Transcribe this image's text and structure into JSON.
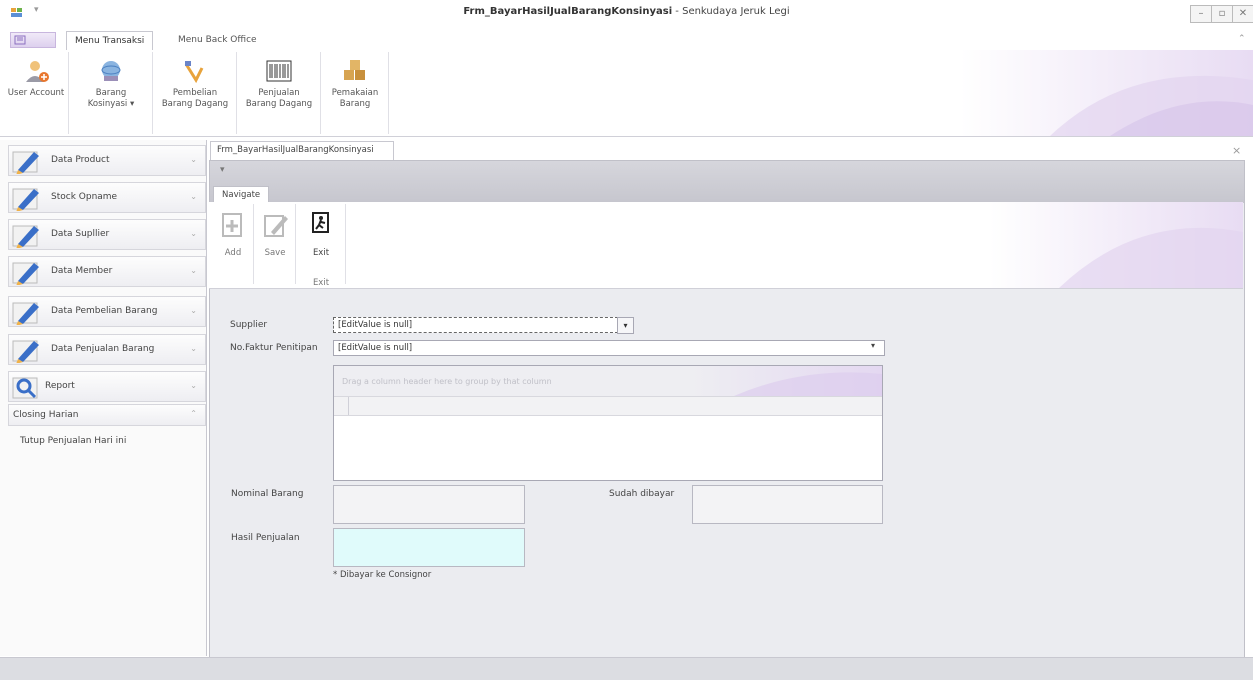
{
  "window": {
    "title_bold": "Frm_BayarHasilJualBarangKonsinyasi",
    "title_rest": " - Senkudaya Jeruk Legi",
    "buttons": [
      "–",
      "▫",
      "✕"
    ]
  },
  "ribbon": {
    "tabs": [
      "Menu Transaksi",
      "Menu Back Office"
    ],
    "buttons": [
      {
        "line1": "User Account",
        "line2": ""
      },
      {
        "line1": "Barang",
        "line2": "Kosinyasi ▾"
      },
      {
        "line1": "Pembelian",
        "line2": "Barang Dagang"
      },
      {
        "line1": "Penjualan",
        "line2": "Barang Dagang"
      },
      {
        "line1": "Pemakaian",
        "line2": "Barang"
      }
    ]
  },
  "sidebar": {
    "items": [
      {
        "label": "Data Product"
      },
      {
        "label": "Stock Opname"
      },
      {
        "label": "Data Supllier"
      },
      {
        "label": "Data Member"
      },
      {
        "label": "Data Pembelian Barang"
      },
      {
        "label": "Data Penjualan Barang"
      },
      {
        "label": "Report"
      }
    ],
    "closing": {
      "label": "Closing Harian",
      "sub_item": "Tutup Penjualan Hari ini"
    }
  },
  "document": {
    "tab_title": "Frm_BayarHasilJualBarangKonsinyasi",
    "inner_tab": "Navigate",
    "buttons": [
      "Add",
      "Save",
      "Exit"
    ],
    "group_label": "Exit",
    "close": "×"
  },
  "form": {
    "supplier_label": "Supplier",
    "supplier_value": "[EditValue is null]",
    "faktur_label": "No.Faktur Penitipan",
    "faktur_value": "[EditValue is null]",
    "grid_group_hint": "Drag a column header here to group by that column",
    "nominal_label": "Nominal Barang",
    "sudah_label": "Sudah dibayar",
    "hasil_label": "Hasil Penjualan",
    "note": "* Dibayar ke Consignor"
  },
  "colors": {
    "accent": "#8b6fc0",
    "highlight_box": "#e0fbfb"
  }
}
